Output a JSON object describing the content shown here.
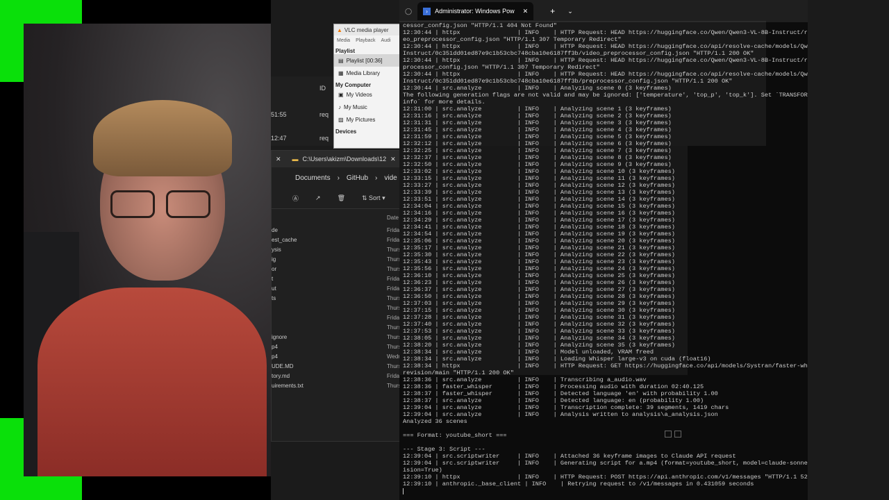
{
  "vlc": {
    "title": "VLC media player",
    "menu": [
      "Media",
      "Playback",
      "Audi"
    ],
    "sections": {
      "playlist": "Playlist",
      "my_computer": "My Computer",
      "devices": "Devices"
    },
    "items": {
      "playlist_item": "Playlist [00:36]",
      "media_library": "Media Library",
      "my_videos": "My Videos",
      "my_music": "My Music",
      "my_pictures": "My Pictures"
    }
  },
  "left_list": {
    "id_header": "ID",
    "rows": [
      {
        "time": "51:55",
        "value": "req"
      },
      {
        "time": "12:47",
        "value": "req"
      }
    ]
  },
  "explorer": {
    "tab_path": "C:\\Users\\akizm\\Downloads\\12",
    "crumbs": [
      "Documents",
      "GitHub",
      "vide"
    ],
    "toolbar": {
      "sort": "Sort"
    },
    "column_date": "Date",
    "rows": [
      {
        "name": "de",
        "date": "Frida"
      },
      {
        "name": "est_cache",
        "date": "Frida"
      },
      {
        "name": "ysis",
        "date": "Thurs"
      },
      {
        "name": "ig",
        "date": "Thurs"
      },
      {
        "name": "or",
        "date": "Thurs"
      },
      {
        "name": "t",
        "date": "Frida"
      },
      {
        "name": "ut",
        "date": "Frida"
      },
      {
        "name": "ts",
        "date": "Thurs"
      },
      {
        "name": "",
        "date": "Thurs"
      },
      {
        "name": "",
        "date": "Frida"
      },
      {
        "name": "",
        "date": "Thurs"
      },
      {
        "name": "ignore",
        "date": "Thurs"
      },
      {
        "name": "p4",
        "date": "Thurs"
      },
      {
        "name": "p4",
        "date": "Wedn"
      },
      {
        "name": "UDE.MD",
        "date": "Thurs"
      },
      {
        "name": "tory.md",
        "date": "Frida"
      },
      {
        "name": "uirements.txt",
        "date": "Thurs"
      }
    ]
  },
  "terminal": {
    "tab_title": "Administrator: Windows Pow",
    "lines": [
      "cessor_config.json \"HTTP/1.1 404 Not Found\"",
      "12:30:44 | httpx                | INFO    | HTTP Request: HEAD https://huggingface.co/Qwen/Qwen3-VL-8B-Instruct/resolve/main/vid",
      "eo_preprocessor_config.json \"HTTP/1.1 307 Temporary Redirect\"",
      "12:30:44 | httpx                | INFO    | HTTP Request: HEAD https://huggingface.co/api/resolve-cache/models/Qwen/Qwen3-VL-8B-",
      "Instruct/0c351dd01ed87e9c1b53cbc748cba10e6187ff3b/video_preprocessor_config.json \"HTTP/1.1 200 OK\"",
      "12:30:44 | httpx                | INFO    | HTTP Request: HEAD https://huggingface.co/Qwen/Qwen3-VL-8B-Instruct/resolve/main/pre",
      "processor_config.json \"HTTP/1.1 307 Temporary Redirect\"",
      "12:30:44 | httpx                | INFO    | HTTP Request: HEAD https://huggingface.co/api/resolve-cache/models/Qwen/Qwen3-VL-8B-",
      "Instruct/0c351dd01ed87e9c1b53cbc748cba10e6187ff3b/preprocessor_config.json \"HTTP/1.1 200 OK\"",
      "12:30:44 | src.analyze          | INFO    | Analyzing scene 0 (3 keyframes)",
      "The following generation flags are not valid and may be ignored: ['temperature', 'top_p', 'top_k']. Set `TRANSFORMERS_VERBOSITY=",
      "info` for more details.",
      "12:31:00 | src.analyze          | INFO    | Analyzing scene 1 (3 keyframes)",
      "12:31:16 | src.analyze          | INFO    | Analyzing scene 2 (3 keyframes)",
      "12:31:31 | src.analyze          | INFO    | Analyzing scene 3 (3 keyframes)",
      "12:31:45 | src.analyze          | INFO    | Analyzing scene 4 (3 keyframes)",
      "12:31:59 | src.analyze          | INFO    | Analyzing scene 5 (3 keyframes)",
      "12:32:12 | src.analyze          | INFO    | Analyzing scene 6 (3 keyframes)",
      "12:32:25 | src.analyze          | INFO    | Analyzing scene 7 (3 keyframes)",
      "12:32:37 | src.analyze          | INFO    | Analyzing scene 8 (3 keyframes)",
      "12:32:50 | src.analyze          | INFO    | Analyzing scene 9 (3 keyframes)",
      "12:33:02 | src.analyze          | INFO    | Analyzing scene 10 (3 keyframes)",
      "12:33:15 | src.analyze          | INFO    | Analyzing scene 11 (3 keyframes)",
      "12:33:27 | src.analyze          | INFO    | Analyzing scene 12 (3 keyframes)",
      "12:33:39 | src.analyze          | INFO    | Analyzing scene 13 (3 keyframes)",
      "12:33:51 | src.analyze          | INFO    | Analyzing scene 14 (3 keyframes)",
      "12:34:04 | src.analyze          | INFO    | Analyzing scene 15 (3 keyframes)",
      "12:34:16 | src.analyze          | INFO    | Analyzing scene 16 (3 keyframes)",
      "12:34:29 | src.analyze          | INFO    | Analyzing scene 17 (3 keyframes)",
      "12:34:41 | src.analyze          | INFO    | Analyzing scene 18 (3 keyframes)",
      "12:34:54 | src.analyze          | INFO    | Analyzing scene 19 (3 keyframes)",
      "12:35:06 | src.analyze          | INFO    | Analyzing scene 20 (3 keyframes)",
      "12:35:17 | src.analyze          | INFO    | Analyzing scene 21 (3 keyframes)",
      "12:35:30 | src.analyze          | INFO    | Analyzing scene 22 (3 keyframes)",
      "12:35:43 | src.analyze          | INFO    | Analyzing scene 23 (3 keyframes)",
      "12:35:56 | src.analyze          | INFO    | Analyzing scene 24 (3 keyframes)",
      "12:36:10 | src.analyze          | INFO    | Analyzing scene 25 (3 keyframes)",
      "12:36:23 | src.analyze          | INFO    | Analyzing scene 26 (3 keyframes)",
      "12:36:37 | src.analyze          | INFO    | Analyzing scene 27 (3 keyframes)",
      "12:36:50 | src.analyze          | INFO    | Analyzing scene 28 (3 keyframes)",
      "12:37:03 | src.analyze          | INFO    | Analyzing scene 29 (3 keyframes)",
      "12:37:15 | src.analyze          | INFO    | Analyzing scene 30 (3 keyframes)",
      "12:37:28 | src.analyze          | INFO    | Analyzing scene 31 (3 keyframes)",
      "12:37:40 | src.analyze          | INFO    | Analyzing scene 32 (3 keyframes)",
      "12:37:53 | src.analyze          | INFO    | Analyzing scene 33 (3 keyframes)",
      "12:38:05 | src.analyze          | INFO    | Analyzing scene 34 (3 keyframes)",
      "12:38:20 | src.analyze          | INFO    | Analyzing scene 35 (3 keyframes)",
      "12:38:34 | src.analyze          | INFO    | Model unloaded, VRAM freed",
      "12:38:34 | src.analyze          | INFO    | Loading Whisper large-v3 on cuda (float16)",
      "12:38:34 | httpx                | INFO    | HTTP Request: GET https://huggingface.co/api/models/Systran/faster-whisper-large-v3/",
      "revision/main \"HTTP/1.1 200 OK\"",
      "12:38:36 | src.analyze          | INFO    | Transcribing a_audio.wav",
      "12:38:36 | faster_whisper       | INFO    | Processing audio with duration 02:40.125",
      "12:38:37 | faster_whisper       | INFO    | Detected language 'en' with probability 1.00",
      "12:38:37 | src.analyze          | INFO    | Detected language: en (probability 1.00)",
      "12:39:04 | src.analyze          | INFO    | Transcription complete: 39 segments, 1419 chars",
      "12:39:04 | src.analyze          | INFO    | Analysis written to analysis\\a_analysis.json",
      "Analyzed 36 scenes",
      "",
      "=== Format: youtube_short ===",
      "",
      "--- Stage 3: Script ---",
      "12:39:04 | src.scriptwriter     | INFO    | Attached 36 keyframe images to Claude API request",
      "12:39:04 | src.scriptwriter     | INFO    | Generating script for a.mp4 (format=youtube_short, model=claude-sonnet-4-20250514, v",
      "ision=True)",
      "12:39:10 | httpx                | INFO    | HTTP Request: POST https://api.anthropic.com/v1/messages \"HTTP/1.1 529 \"",
      "12:39:10 | anthropic._base_client | INFO    | Retrying request to /v1/messages in 0.431059 seconds"
    ]
  },
  "colors": {
    "chroma_green": "#0ae00a",
    "terminal_bg": "#0c0c0c",
    "terminal_text": "#cccccc"
  }
}
